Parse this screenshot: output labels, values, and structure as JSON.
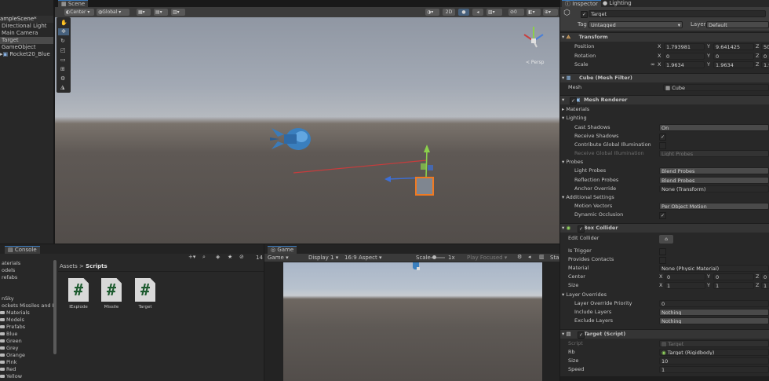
{
  "hierarchy": {
    "items": [
      "ampleScene*",
      "Directional Light",
      "Main Camera",
      "Target",
      "GameObject",
      "Rocket20_Blue"
    ]
  },
  "scene": {
    "tab": "Scene",
    "pivot": "Center",
    "space": "Global",
    "mode_2d": "2D",
    "persp_label": "< Persp"
  },
  "console": {
    "tab": "Console",
    "count": "14"
  },
  "project": {
    "tree": [
      "aterials",
      "odels",
      "refabs",
      "",
      "nSky",
      "ockets Missiles and Bo",
      "Materials",
      "Models",
      "Prefabs",
      "Blue",
      "Green",
      "Grey",
      "Orange",
      "Pink",
      "Red",
      "Yellow"
    ],
    "breadcrumb_root": "Assets",
    "breadcrumb_sep": ">",
    "breadcrumb_leaf": "Scripts",
    "assets": [
      "IExplode",
      "Missile",
      "Target"
    ],
    "hash_glyph": "#"
  },
  "game": {
    "tab": "Game",
    "view": "Game",
    "display": "Display 1",
    "aspect": "16:9 Aspect",
    "scale_label": "Scale",
    "scale_value": "1x",
    "play_mode": "Play Focused",
    "stats": "Sta"
  },
  "inspector": {
    "tab_inspector": "Inspector",
    "tab_lighting": "Lighting",
    "object_name": "Target",
    "tag_label": "Tag",
    "tag_value": "Untagged",
    "layer_label": "Layer",
    "layer_value": "Default",
    "transform": {
      "title": "Transform",
      "position_label": "Position",
      "position": [
        "1.793981",
        "9.641425",
        "50."
      ],
      "rotation_label": "Rotation",
      "rotation": [
        "0",
        "0",
        "0"
      ],
      "scale_label": "Scale",
      "scale": [
        "1.9634",
        "1.9634",
        "1.9"
      ]
    },
    "mesh_filter": {
      "title": "Cube (Mesh Filter)",
      "mesh_label": "Mesh",
      "mesh_value": "Cube"
    },
    "mesh_renderer": {
      "title": "Mesh Renderer",
      "materials": "Materials",
      "lighting": "Lighting",
      "cast_shadows_label": "Cast Shadows",
      "cast_shadows": "On",
      "receive_shadows_label": "Receive Shadows",
      "contribute_gi_label": "Contribute Global Illumination",
      "receive_gi_label": "Receive Global Illumination",
      "receive_gi": "Light Probes",
      "probes": "Probes",
      "light_probes_label": "Light Probes",
      "light_probes": "Blend Probes",
      "reflection_probes_label": "Reflection Probes",
      "reflection_probes": "Blend Probes",
      "anchor_label": "Anchor Override",
      "anchor": "None (Transform)",
      "additional": "Additional Settings",
      "motion_label": "Motion Vectors",
      "motion": "Per Object Motion",
      "occlusion_label": "Dynamic Occlusion"
    },
    "box_collider": {
      "title": "Box Collider",
      "edit_label": "Edit Collider",
      "trigger_label": "Is Trigger",
      "contacts_label": "Provides Contacts",
      "material_label": "Material",
      "material": "None (Physic Material)",
      "center_label": "Center",
      "center": [
        "0",
        "0",
        "0"
      ],
      "size_label": "Size",
      "size": [
        "1",
        "1",
        "1"
      ],
      "overrides": "Layer Overrides",
      "priority_label": "Layer Override Priority",
      "priority": "0",
      "include_label": "Include Layers",
      "include": "Nothing",
      "exclude_label": "Exclude Layers",
      "exclude": "Nothing"
    },
    "target_script": {
      "title": "Target (Script)",
      "script_label": "Script",
      "script": "Target",
      "rb_label": "Rb",
      "rb": "Target (Rigidbody)",
      "size_label": "Size",
      "size": "10",
      "speed_label": "Speed",
      "speed": "1"
    },
    "axes": [
      "X",
      "Y",
      "Z"
    ],
    "check_glyph": "✓"
  },
  "colors": {
    "accent": "#3a79bb",
    "selection": "#2c5d87",
    "script_hash": "#1d5b2f"
  }
}
